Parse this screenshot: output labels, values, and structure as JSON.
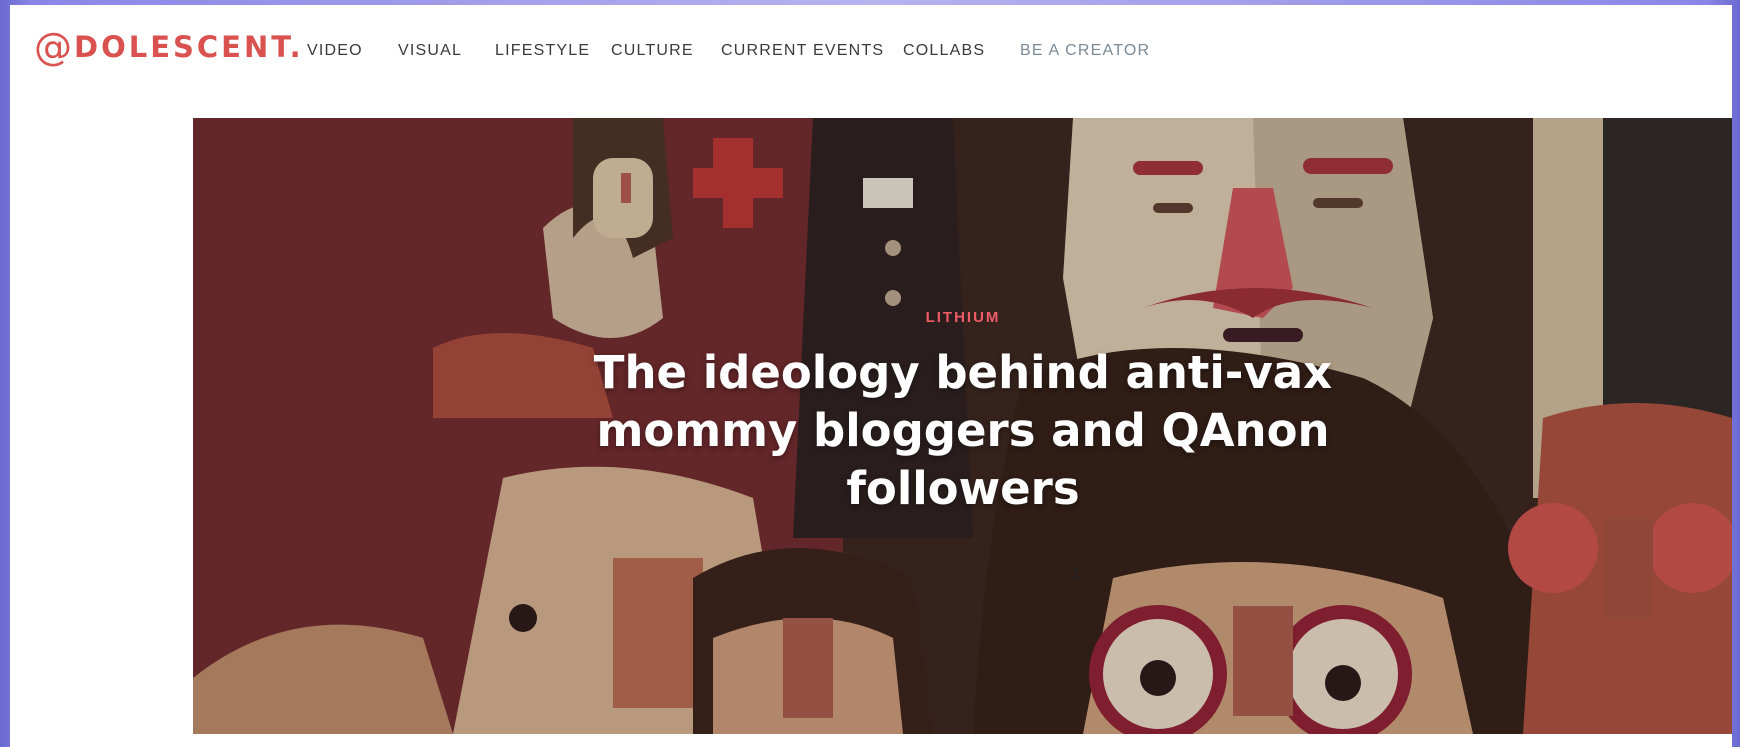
{
  "brand": {
    "logo_at": "@",
    "logo_text": "DOLESCENT."
  },
  "nav": {
    "items": [
      {
        "label": "VIDEO"
      },
      {
        "label": "VISUAL"
      },
      {
        "label": "LIFESTYLE"
      },
      {
        "label": "CULTURE"
      },
      {
        "label": "CURRENT EVENTS"
      },
      {
        "label": "COLLABS"
      },
      {
        "label": "BE A CREATOR"
      }
    ]
  },
  "hero": {
    "category": "LITHIUM",
    "title_lines": [
      "The ideology behind anti-vax",
      "mommy bloggers and QAnon",
      "followers"
    ]
  },
  "colors": {
    "brand_accent": "#d9524f",
    "category_accent": "#ef5b67",
    "hero_background": "#6b2a2c"
  }
}
